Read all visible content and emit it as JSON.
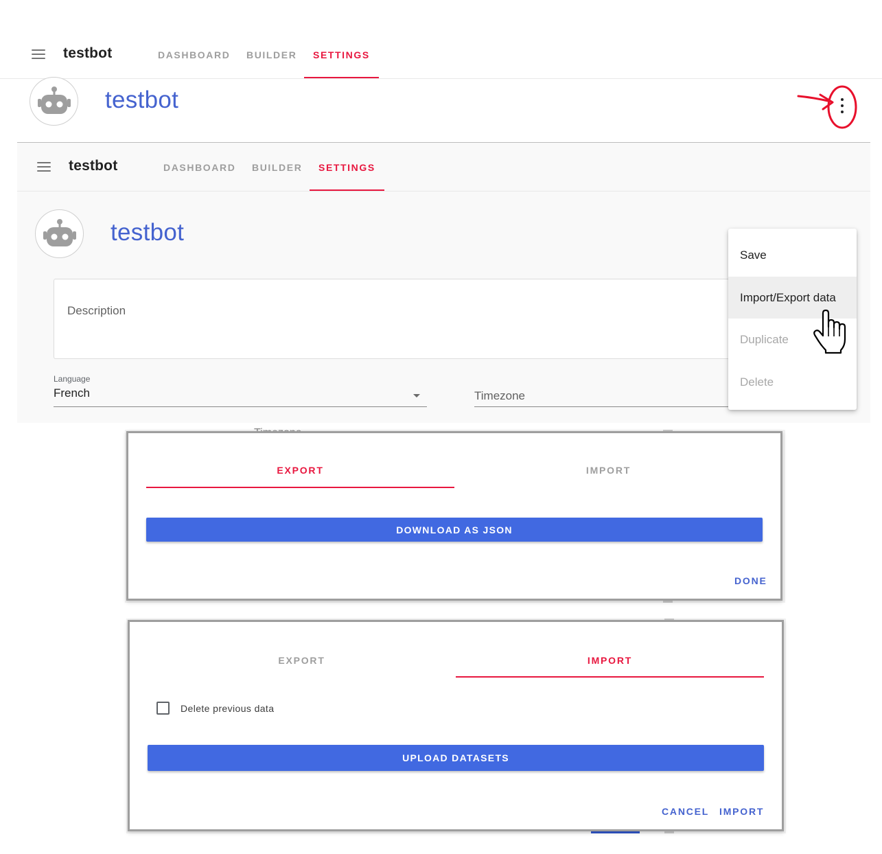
{
  "appbar": {
    "title": "testbot",
    "tabs": [
      {
        "label": "DASHBOARD",
        "active": false
      },
      {
        "label": "BUILDER",
        "active": false
      },
      {
        "label": "SETTINGS",
        "active": true
      }
    ]
  },
  "header": {
    "bot_name": "testbot"
  },
  "settings_form": {
    "description_placeholder": "Description",
    "language_caption": "Language",
    "language_value": "French",
    "timezone_placeholder": "Timezone",
    "obscured_timezone_text": "Timezone"
  },
  "more_menu": {
    "items": [
      {
        "label": "Save",
        "state": "normal"
      },
      {
        "label": "Import/Export data",
        "state": "hover"
      },
      {
        "label": "Duplicate",
        "state": "disabled"
      },
      {
        "label": "Delete",
        "state": "disabled"
      }
    ]
  },
  "export_dialog": {
    "tabs": [
      {
        "label": "EXPORT",
        "active": true
      },
      {
        "label": "IMPORT",
        "active": false
      }
    ],
    "download_label": "DOWNLOAD AS JSON",
    "done_label": "DONE"
  },
  "import_dialog": {
    "tabs": [
      {
        "label": "EXPORT",
        "active": false
      },
      {
        "label": "IMPORT",
        "active": true
      }
    ],
    "checkbox_label": "Delete previous data",
    "checkbox_checked": false,
    "upload_label": "UPLOAD DATASETS",
    "cancel_label": "CANCEL",
    "import_label": "IMPORT"
  },
  "colors": {
    "accent": "#e8173f",
    "primary": "#4169e1",
    "link": "#4563cf",
    "annotation": "#e8102c"
  }
}
